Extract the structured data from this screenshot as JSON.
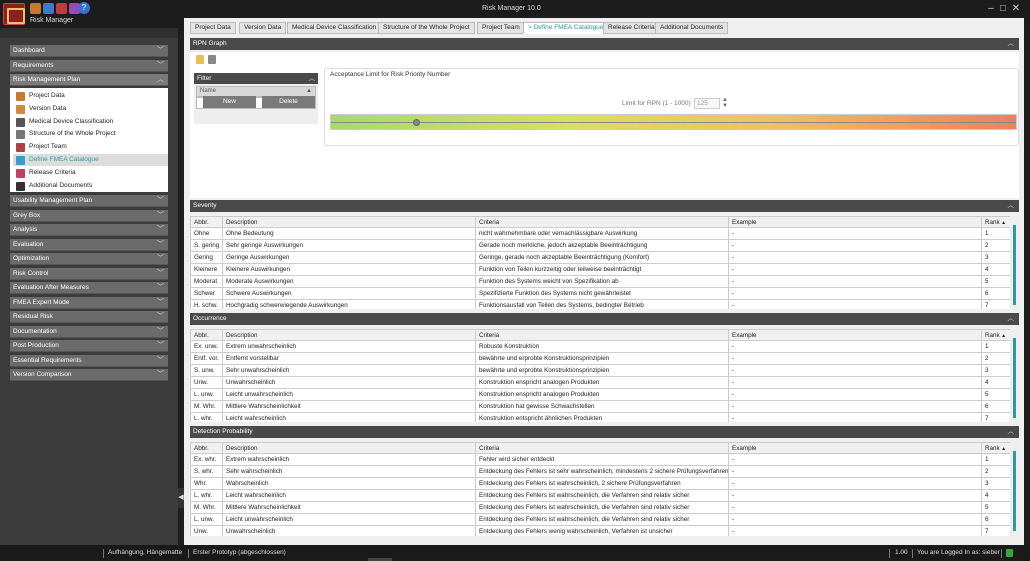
{
  "app": {
    "title": "Risk Manager   10.0",
    "name": "Risk Manager",
    "accent": "#2a9d9a"
  },
  "sidebar": {
    "groups_top": [
      {
        "label": "Dashboard"
      },
      {
        "label": "Requirements"
      },
      {
        "label": "Risk Management Plan"
      }
    ],
    "sub_items": [
      {
        "label": "Project Data",
        "icon": "project-data-icon",
        "selected": false
      },
      {
        "label": "Version Data",
        "icon": "version-data-icon",
        "selected": false
      },
      {
        "label": "Medical Device Classification",
        "icon": "classification-icon",
        "selected": false
      },
      {
        "label": "Structure of the Whole Project",
        "icon": "structure-icon",
        "selected": false
      },
      {
        "label": "Project Team",
        "icon": "team-icon",
        "selected": false
      },
      {
        "label": "Define FMEA Catalogue",
        "icon": "catalogue-icon",
        "selected": true
      },
      {
        "label": "Release Criteria",
        "icon": "release-icon",
        "selected": false
      },
      {
        "label": "Additional Documents",
        "icon": "documents-icon",
        "selected": false
      }
    ],
    "groups_bottom": [
      {
        "label": "Usability Management Plan"
      },
      {
        "label": "Grey Box"
      },
      {
        "label": "Analysis"
      },
      {
        "label": "Evaluation"
      },
      {
        "label": "Optimization"
      },
      {
        "label": "Risk Control"
      },
      {
        "label": "Evaluation After Measures"
      },
      {
        "label": "FMEA Expert Mode"
      },
      {
        "label": "Residual Risk"
      },
      {
        "label": "Documentation"
      },
      {
        "label": "Post Production"
      },
      {
        "label": "Essential Requirements"
      },
      {
        "label": "Version Comparison"
      }
    ]
  },
  "tabs": [
    {
      "label": "Project Data"
    },
    {
      "label": "Version Data"
    },
    {
      "label": "Medical Device Classification"
    },
    {
      "label": "Structure of the Whole Project"
    },
    {
      "label": "Project Team"
    },
    {
      "label": "> Define FMEA Catalogue"
    },
    {
      "label": "Release Criteria"
    },
    {
      "label": "Additional Documents"
    }
  ],
  "rpn": {
    "title": "RPN Graph",
    "filter_title": "Filter",
    "name_header": "Name",
    "new_label": "New",
    "delete_label": "Delete",
    "accept_title": "Acceptance Limit for Risk Priority Number",
    "limit_label": "Limit for RPN (1 - 1000)",
    "limit_value": "125",
    "slider_level_fraction": 0.125
  },
  "columns": {
    "abbr": "Abbr.",
    "description": "Description",
    "criteria": "Criteria",
    "example": "Example",
    "rank": "Rank"
  },
  "severity": {
    "title": "Severity",
    "rows": [
      {
        "abbr": "Ohne",
        "desc": "Ohne Bedeutung",
        "criteria": "nicht wahrnehmbare oder vernachlässigbare Auswirkung",
        "example": "-",
        "rank": "1"
      },
      {
        "abbr": "S. gering",
        "desc": "Sehr geringe Auswirkungen",
        "criteria": "Gerade noch merkliche, jedoch akzeptable Beeinträchtigung",
        "example": "-",
        "rank": "2"
      },
      {
        "abbr": "Gering",
        "desc": "Geringe Auswirkungen",
        "criteria": "Geringe, gerade noch akzeptable Beeinträchtigung (Komfort)",
        "example": "-",
        "rank": "3"
      },
      {
        "abbr": "Kleinere",
        "desc": "Kleinere Auswirkungen",
        "criteria": "Funktion von Teilen kurzzeitig oder teilweise beeinträchtigt",
        "example": "-",
        "rank": "4"
      },
      {
        "abbr": "Moderat",
        "desc": "Moderate Auswirkungen",
        "criteria": "Funktion des Systems weicht von Spezifikation ab",
        "example": "-",
        "rank": "5"
      },
      {
        "abbr": "Schwer",
        "desc": "Schwere Auswirkungen",
        "criteria": "Spezifizierte Funktion des Systems nicht gewährleistet",
        "example": "-",
        "rank": "6"
      },
      {
        "abbr": "H. schw.",
        "desc": "Hochgradig schwerwiegende Auswirkungen",
        "criteria": "Funktionsausfall von Teilen des Systems, bedingter Betrieb",
        "example": "-",
        "rank": "7"
      }
    ]
  },
  "occurrence": {
    "title": "Occurrence",
    "rows": [
      {
        "abbr": "Ex. unw.",
        "desc": "Extrem unwahrscheinlich",
        "criteria": "Robuste Konstruktion",
        "example": "-",
        "rank": "1"
      },
      {
        "abbr": "Entf. vor.",
        "desc": "Entfernt vorstellbar",
        "criteria": "bewährte und erprobte Konstruktionsprinzipien",
        "example": "-",
        "rank": "2"
      },
      {
        "abbr": "S. unw.",
        "desc": "Sehr unwahrscheinlich",
        "criteria": "bewährte und erprobte Konstruktionsprinzipien",
        "example": "-",
        "rank": "3"
      },
      {
        "abbr": "Unw.",
        "desc": "Unwahrscheinlich",
        "criteria": "Konstruktion enspricht analogen Produkten",
        "example": "-",
        "rank": "4"
      },
      {
        "abbr": "L. unw.",
        "desc": "Leicht unwahrscheinlich",
        "criteria": "Konstruktion enspricht analogen Produkten",
        "example": "-",
        "rank": "5"
      },
      {
        "abbr": "M. Whr.",
        "desc": "Mittlere Wahrscheinlichkeit",
        "criteria": "Konstruktion hat gewisse Schwachstellen",
        "example": "-",
        "rank": "6"
      },
      {
        "abbr": "L. whr.",
        "desc": "Leicht wahrscheinlich",
        "criteria": "Konstruktion entspricht ähnlichen Produkten",
        "example": "-",
        "rank": "7"
      }
    ]
  },
  "detection": {
    "title": "Detection Probability",
    "rows": [
      {
        "abbr": "Ex. whr.",
        "desc": "Extrem wahrscheinlich",
        "criteria": "Fehler wird sicher entdeckt",
        "example": "-",
        "rank": "1"
      },
      {
        "abbr": "S. whr.",
        "desc": "Sehr wahrscheinlich",
        "criteria": "Entdeckung des Fehlers ist sehr wahrscheinlich, mindestens 2 sichere Prüfungsverfahren",
        "example": "-",
        "rank": "2"
      },
      {
        "abbr": "Whr.",
        "desc": "Wahrscheinlich",
        "criteria": "Entdeckung des Fehlers ist wahrscheinlich, 2 sichere Prüfungsverfahren",
        "example": "-",
        "rank": "3"
      },
      {
        "abbr": "L. whr.",
        "desc": "Leicht wahrscheinlich",
        "criteria": "Entdeckung des Fehlers ist wahrscheinlich, die Verfahren sind relativ sicher",
        "example": "-",
        "rank": "4"
      },
      {
        "abbr": "M. Whr.",
        "desc": "Mittlere Wahrscheinlichkeit",
        "criteria": "Entdeckung des Fehlers ist wahrscheinlich, die Verfahren sind relativ sicher",
        "example": "-",
        "rank": "5"
      },
      {
        "abbr": "L. unw.",
        "desc": "Leicht unwahrscheinlich",
        "criteria": "Entdeckung des Fehlers ist wahrscheinlich, die Verfahren sind relativ sicher",
        "example": "-",
        "rank": "6"
      },
      {
        "abbr": "Unw.",
        "desc": "Unwahrscheinlich",
        "criteria": "Entdeckung des Fehlers wenig wahrscheinlich, Verfahren ist unsicher",
        "example": "-",
        "rank": "7"
      }
    ]
  },
  "status": {
    "project": "Aufhängung, Hängematte",
    "version": "Erster Prototyp (abgeschlossen)",
    "zoom": "1.00",
    "login": "You are Logged In as: sieber"
  }
}
